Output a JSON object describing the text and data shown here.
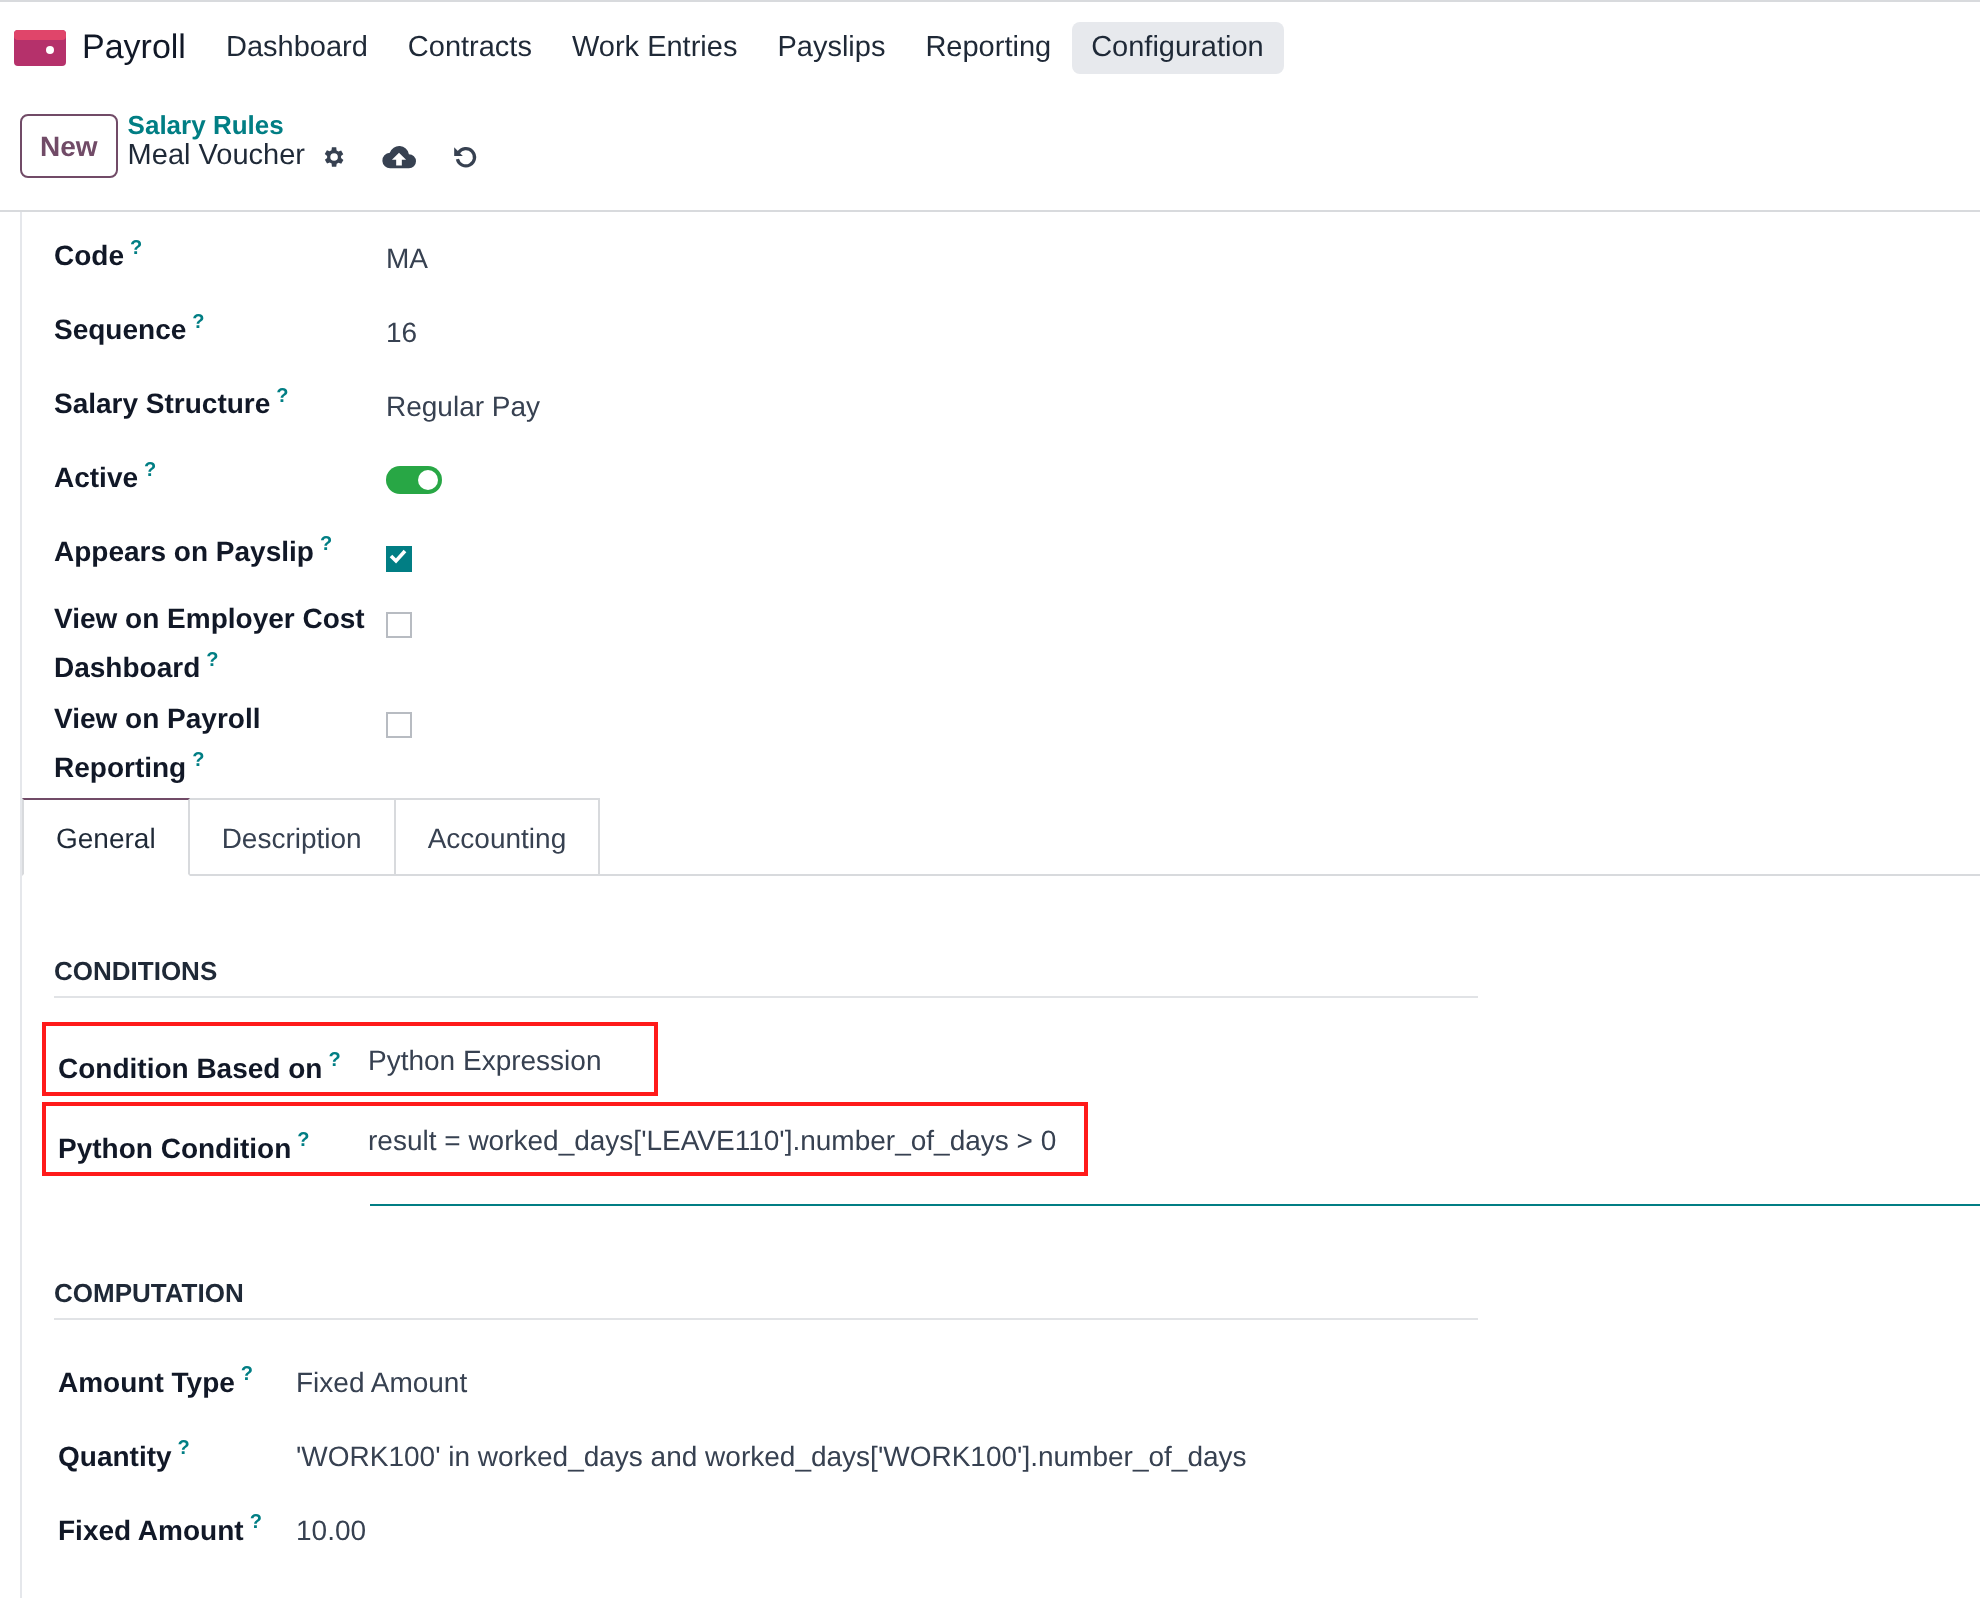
{
  "navbar": {
    "app": "Payroll",
    "menus": [
      {
        "label": "Dashboard",
        "selected": false
      },
      {
        "label": "Contracts",
        "selected": false
      },
      {
        "label": "Work Entries",
        "selected": false
      },
      {
        "label": "Payslips",
        "selected": false
      },
      {
        "label": "Reporting",
        "selected": false
      },
      {
        "label": "Configuration",
        "selected": true
      }
    ]
  },
  "control_panel": {
    "new_button": "New",
    "breadcrumb": "Salary Rules",
    "record": "Meal Voucher"
  },
  "fields": [
    {
      "kind": "text",
      "label": "Code",
      "help": "?",
      "value": "MA"
    },
    {
      "kind": "text",
      "label": "Sequence",
      "help": "?",
      "value": "16"
    },
    {
      "kind": "text",
      "label": "Salary Structure",
      "help": "?",
      "value": "Regular Pay"
    },
    {
      "kind": "toggle",
      "label": "Active",
      "help": "?",
      "on": true
    },
    {
      "kind": "checkbox",
      "label": "Appears on Payslip",
      "help": "?",
      "checked": true
    },
    {
      "kind": "checkbox",
      "label": "View on Employer Cost Dashboard",
      "help": "?",
      "checked": false
    },
    {
      "kind": "checkbox",
      "label": "View on Payroll Reporting",
      "help": "?",
      "checked": false
    }
  ],
  "tabs": [
    {
      "label": "General",
      "selected": true
    },
    {
      "label": "Description",
      "selected": false
    },
    {
      "label": "Accounting",
      "selected": false
    }
  ],
  "sections": [
    {
      "title": "CONDITIONS",
      "fields": [
        {
          "label": "Condition Based on",
          "help": "?",
          "value": "Python Expression",
          "highlighted": true,
          "editing": false
        },
        {
          "label": "Python Condition",
          "help": "?",
          "value": "result = worked_days['LEAVE110'].number_of_days > 0",
          "highlighted": true,
          "editing": true
        }
      ]
    },
    {
      "title": "COMPUTATION",
      "fields": [
        {
          "label": "Amount Type",
          "help": "?",
          "value": "Fixed Amount",
          "highlighted": false,
          "editing": false
        },
        {
          "label": "Quantity",
          "help": "?",
          "value": "'WORK100' in worked_days and worked_days['WORK100'].number_of_days",
          "highlighted": false,
          "editing": false
        },
        {
          "label": "Fixed Amount",
          "help": "?",
          "value": "10.00",
          "highlighted": false,
          "editing": false
        }
      ]
    }
  ]
}
